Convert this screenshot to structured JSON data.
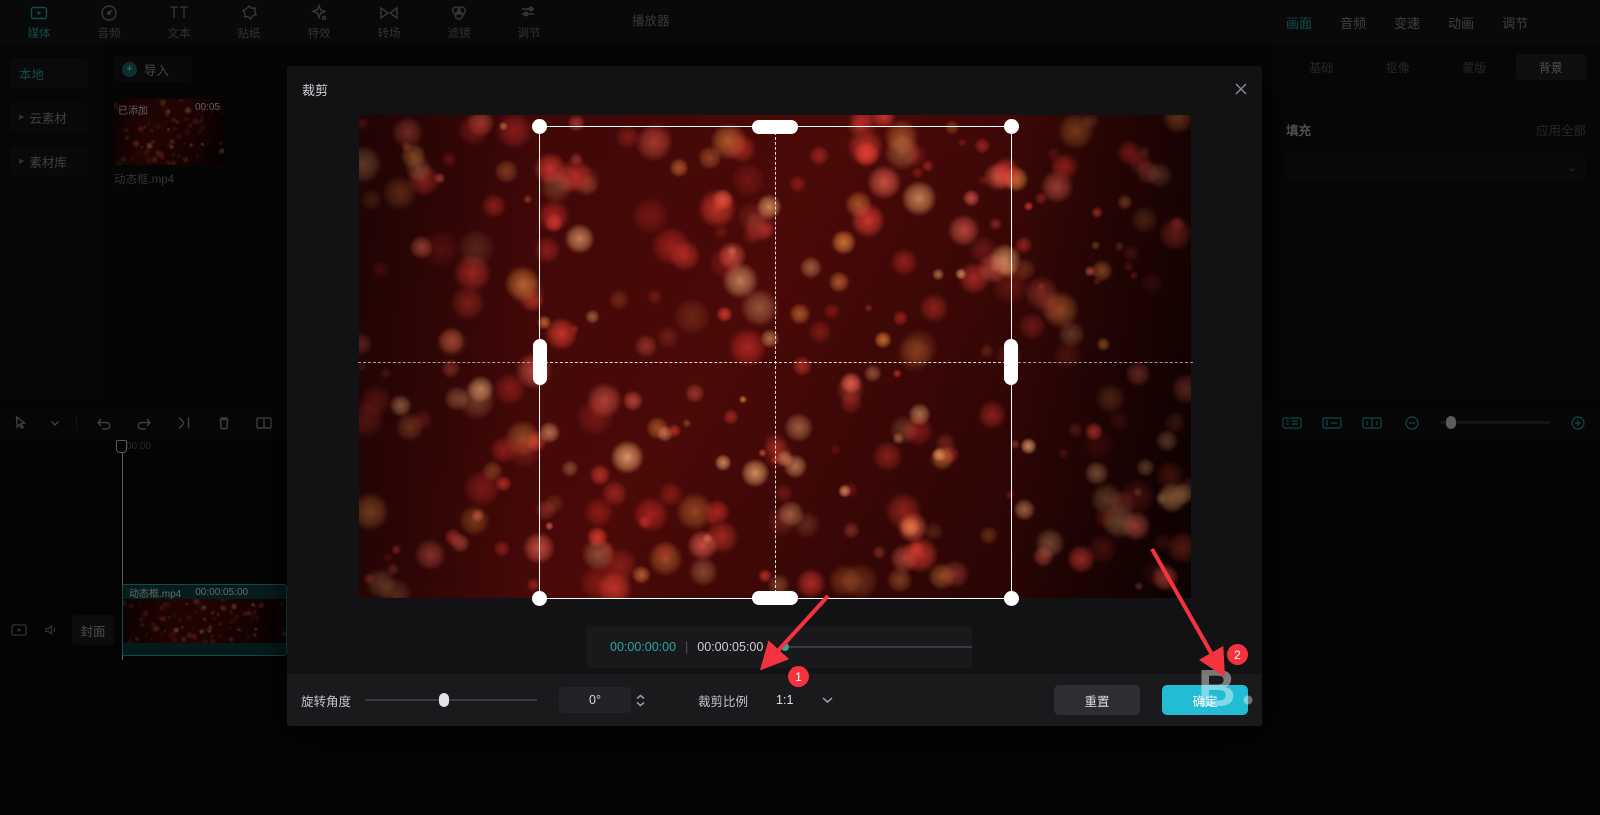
{
  "topnav": {
    "items": [
      {
        "label": "媒体",
        "icon": "media-icon",
        "active": true
      },
      {
        "label": "音频",
        "icon": "audio-icon",
        "active": false
      },
      {
        "label": "文本",
        "icon": "text-icon",
        "active": false
      },
      {
        "label": "贴纸",
        "icon": "sticker-icon",
        "active": false
      },
      {
        "label": "特效",
        "icon": "effects-icon",
        "active": false
      },
      {
        "label": "转场",
        "icon": "transition-icon",
        "active": false
      },
      {
        "label": "滤镜",
        "icon": "filter-icon",
        "active": false
      },
      {
        "label": "调节",
        "icon": "adjust-icon",
        "active": false
      }
    ]
  },
  "leftrail": {
    "items": [
      {
        "label": "本地",
        "active": true,
        "expandable": false
      },
      {
        "label": "云素材",
        "active": false,
        "expandable": true
      },
      {
        "label": "素材库",
        "active": false,
        "expandable": true
      }
    ]
  },
  "media": {
    "import_label": "导入",
    "thumb_badge": "已添加",
    "thumb_duration": "00:05",
    "thumb_name": "动态框.mp4"
  },
  "player": {
    "label": "播放器"
  },
  "rightpanel": {
    "tabs": [
      {
        "label": "画面",
        "active": true
      },
      {
        "label": "音频",
        "active": false
      },
      {
        "label": "变速",
        "active": false
      },
      {
        "label": "动画",
        "active": false
      },
      {
        "label": "调节",
        "active": false
      }
    ],
    "subtabs": [
      {
        "label": "基础",
        "active": false
      },
      {
        "label": "抠像",
        "active": false
      },
      {
        "label": "蒙版",
        "active": false
      },
      {
        "label": "背景",
        "active": true
      }
    ],
    "fill_label": "填充",
    "apply_all_label": "应用全部",
    "fill_value": ""
  },
  "timeline": {
    "toolbar": [
      {
        "name": "select-tool",
        "icon": "cursor-icon"
      },
      {
        "name": "select-dropdown",
        "icon": "chevron-down-icon"
      },
      {
        "name": "undo",
        "icon": "undo-icon"
      },
      {
        "name": "redo",
        "icon": "redo-icon"
      },
      {
        "name": "split",
        "icon": "split-icon"
      },
      {
        "name": "delete",
        "icon": "trash-icon"
      },
      {
        "name": "mirror",
        "icon": "mirror-icon"
      },
      {
        "name": "preview",
        "icon": "play-circle-icon"
      }
    ],
    "ruler_time": "00:00",
    "cover_label": "封面",
    "clip_name": "动态框.mp4",
    "clip_duration": "00:00:05:00",
    "right_tools": [
      {
        "name": "auto-cut-icon"
      },
      {
        "name": "speed-icon"
      },
      {
        "name": "split-view-icon"
      },
      {
        "name": "zoom-out-icon"
      },
      {
        "name": "zoom-in-icon"
      }
    ]
  },
  "modal": {
    "title": "裁剪",
    "close_icon": "close-icon",
    "playback": {
      "current_time": "00:00:00:00",
      "separator": "|",
      "total_time": "00:00:05:00"
    },
    "bottom": {
      "rotation_label": "旋转角度",
      "rotation_value": "0°",
      "ratio_label": "裁剪比例",
      "ratio_value": "1:1",
      "reset_label": "重置",
      "confirm_label": "确定"
    }
  },
  "annotations": [
    {
      "number": "1",
      "color": "#f5333f"
    },
    {
      "number": "2",
      "color": "#f5333f"
    }
  ],
  "colors": {
    "accent_cyan": "#2ba6a0",
    "confirm_blue": "#22bcd4",
    "annotation_red": "#f5333f",
    "panel_bg": "#121214"
  }
}
